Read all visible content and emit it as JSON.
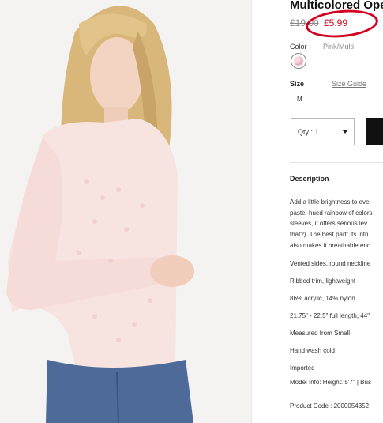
{
  "product": {
    "title": "Multicolored Ope",
    "price_original": "£19.00",
    "price_sale": "£5.99"
  },
  "color": {
    "label": "Color",
    "separator": ":",
    "value": "Pink/Multi",
    "swatch_color": "#f2c6d2"
  },
  "size": {
    "label": "Size",
    "guide_link": "Size Guide",
    "option": "M"
  },
  "quantity": {
    "label": "Qty : 1"
  },
  "description": {
    "heading": "Description",
    "paragraph_lines": [
      "Add a little brightness to eve",
      "pastel-hued rainbow of colors",
      "sleeves, it offers serious lev",
      "that?). The best part: its intri",
      "also makes it breathable enc"
    ],
    "details": [
      "Vented sides, round neckline",
      "Ribbed trim, lightweight",
      "86% acrylic, 14% nylon",
      "21.75\" - 22.5\" full length, 44\"",
      "Measured from Small",
      "Hand wash cold",
      "Imported",
      "Model Info: Height: 5'7\" | Bus",
      "Product Code : 2000054352"
    ]
  },
  "annotation_color": "#d2001f"
}
